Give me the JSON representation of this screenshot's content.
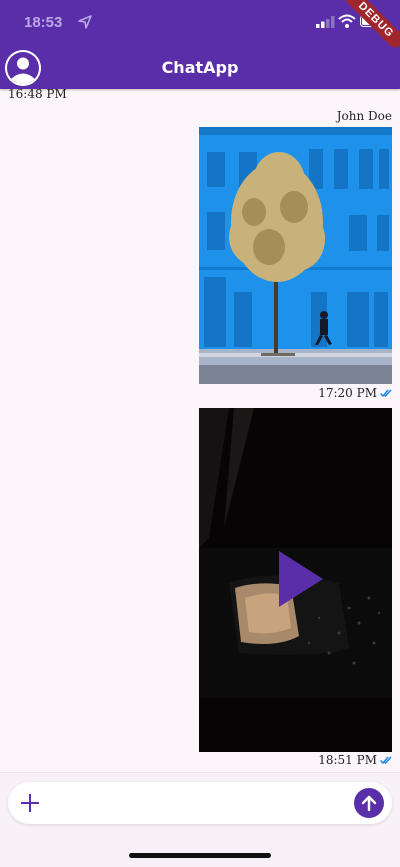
{
  "status_bar": {
    "time": "18:53"
  },
  "debug_banner": "DEBUG",
  "app_bar": {
    "title": "ChatApp"
  },
  "messages": [
    {
      "type": "time",
      "time": "16:48 PM"
    },
    {
      "type": "image",
      "sender": "John Doe",
      "time": "17:20 PM",
      "status": "delivered"
    },
    {
      "type": "video",
      "time": "18:51 PM",
      "status": "delivered"
    }
  ],
  "composer": {
    "placeholder": "",
    "value": ""
  },
  "colors": {
    "accent": "#5a2ea8",
    "background": "#fcf6fb",
    "check": "#1e88e5"
  }
}
